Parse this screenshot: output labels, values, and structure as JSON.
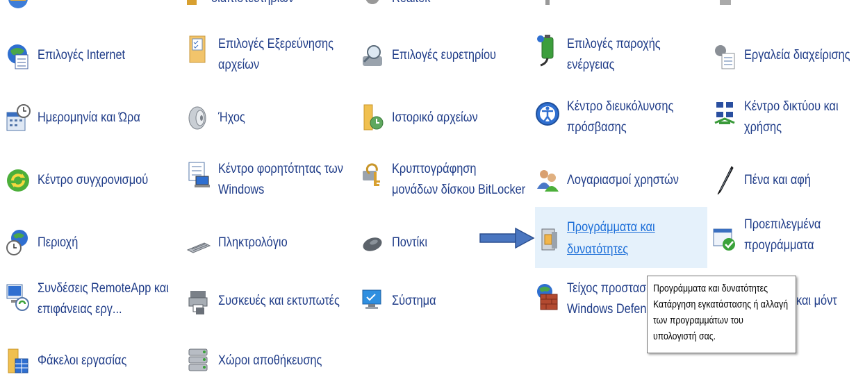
{
  "top_row": [
    {
      "label": "διαπιστευτηρίων",
      "icon": "credential-manager-icon"
    },
    {
      "label": "Realtek",
      "icon": "realtek-audio-icon"
    }
  ],
  "items": [
    {
      "label": [
        "Επιλογές Internet"
      ],
      "icon": "internet-options-icon"
    },
    {
      "label": [
        "Επιλογές Εξερεύνησης",
        "αρχείων"
      ],
      "icon": "file-explorer-options-icon"
    },
    {
      "label": [
        "Επιλογές ευρετηρίου"
      ],
      "icon": "indexing-options-icon"
    },
    {
      "label": [
        "Επιλογές παροχής",
        "ενέργειας"
      ],
      "icon": "power-options-icon"
    },
    {
      "label": [
        "Εργαλεία διαχείρισης"
      ],
      "icon": "administrative-tools-icon"
    },
    {
      "label": [
        "Ημερομηνία και Ώρα"
      ],
      "icon": "date-time-icon"
    },
    {
      "label": [
        "Ήχος"
      ],
      "icon": "sound-icon"
    },
    {
      "label": [
        "Ιστορικό αρχείων"
      ],
      "icon": "file-history-icon"
    },
    {
      "label": [
        "Κέντρο διευκόλυνσης",
        "πρόσβασης"
      ],
      "icon": "ease-of-access-icon"
    },
    {
      "label": [
        "Κέντρο δικτύου και",
        "χρήσης"
      ],
      "icon": "network-sharing-icon"
    },
    {
      "label": [
        "Κέντρο συγχρονισμού"
      ],
      "icon": "sync-center-icon"
    },
    {
      "label": [
        "Κέντρο φορητότητας των",
        "Windows"
      ],
      "icon": "mobility-center-icon"
    },
    {
      "label": [
        "Κρυπτογράφηση",
        "μονάδων δίσκου BitLocker"
      ],
      "icon": "bitlocker-icon"
    },
    {
      "label": [
        "Λογαριασμοί χρηστών"
      ],
      "icon": "user-accounts-icon"
    },
    {
      "label": [
        "Πένα και αφή"
      ],
      "icon": "pen-touch-icon"
    },
    {
      "label": [
        "Περιοχή"
      ],
      "icon": "region-icon"
    },
    {
      "label": [
        "Πληκτρολόγιο"
      ],
      "icon": "keyboard-icon"
    },
    {
      "label": [
        "Ποντίκι"
      ],
      "icon": "mouse-icon"
    },
    {
      "label": [
        "Προγράμματα και",
        "δυνατότητες"
      ],
      "icon": "programs-features-icon"
    },
    {
      "label": [
        "Προεπιλεγμένα",
        "προγράμματα"
      ],
      "icon": "default-programs-icon"
    },
    {
      "label": [
        "Συνδέσεις RemoteApp και",
        "επιφάνειας εργ..."
      ],
      "icon": "remoteapp-icon"
    },
    {
      "label": [
        "Συσκευές και εκτυπωτές"
      ],
      "icon": "devices-printers-icon"
    },
    {
      "label": [
        "Σύστημα"
      ],
      "icon": "system-icon"
    },
    {
      "label": [
        "Τείχος προστασ",
        "Windows Defend"
      ],
      "icon": "firewall-icon"
    },
    {
      "label": [
        "και μόντ"
      ],
      "icon": "phone-modem-icon"
    },
    {
      "label": [
        "Φάκελοι εργασίας"
      ],
      "icon": "work-folders-icon"
    },
    {
      "label": [
        "Χώροι αποθήκευσης"
      ],
      "icon": "storage-spaces-icon"
    }
  ],
  "tooltip": [
    "Προγράμματα και δυνατότητες",
    "Κατάργηση εγκατάστασης ή αλλαγή",
    "των προγραμμάτων του",
    "υπολογιστή σας."
  ],
  "colors": {
    "link": "#1f3c88",
    "hover_bg": "#e5f1fb",
    "hover_link": "#1a6dd8",
    "arrow": "#4a76c0"
  }
}
